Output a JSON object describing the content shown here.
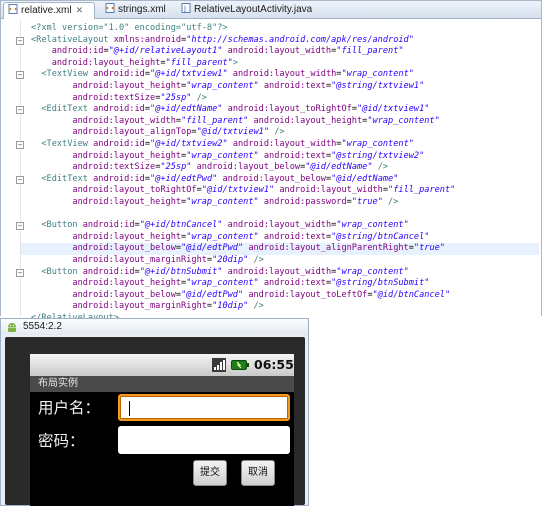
{
  "tabs": [
    {
      "label": "relative.xml",
      "active": true
    },
    {
      "label": "strings.xml",
      "active": false
    },
    {
      "label": "RelativeLayoutActivity.java",
      "active": false
    }
  ],
  "code_lines": [
    [
      [
        "pi",
        "<?xml version=\"1.0\" encoding=\"utf-8\"?>"
      ]
    ],
    [
      [
        "tag",
        "<RelativeLayout "
      ],
      [
        "attr",
        "xmlns:android"
      ],
      [
        "punc",
        "="
      ],
      [
        "val",
        "\"http://schemas.android.com/apk/res/android\""
      ]
    ],
    [
      [
        "attr",
        "    android:id"
      ],
      [
        "punc",
        "="
      ],
      [
        "val",
        "\"@+id/relativeLayout1\""
      ],
      [
        "attr",
        " android:layout_width"
      ],
      [
        "punc",
        "="
      ],
      [
        "val",
        "\"fill_parent\""
      ]
    ],
    [
      [
        "attr",
        "    android:layout_height"
      ],
      [
        "punc",
        "="
      ],
      [
        "val",
        "\"fill_parent\""
      ],
      [
        "tag",
        ">"
      ]
    ],
    [
      [
        "tag",
        "  <TextView "
      ],
      [
        "attr",
        "android:id"
      ],
      [
        "punc",
        "="
      ],
      [
        "val",
        "\"@+id/txtview1\""
      ],
      [
        "attr",
        " android:layout_width"
      ],
      [
        "punc",
        "="
      ],
      [
        "val",
        "\"wrap_content\""
      ]
    ],
    [
      [
        "attr",
        "        android:layout_height"
      ],
      [
        "punc",
        "="
      ],
      [
        "val",
        "\"wrap_content\""
      ],
      [
        "attr",
        " android:text"
      ],
      [
        "punc",
        "="
      ],
      [
        "val",
        "\"@string/txtview1\""
      ]
    ],
    [
      [
        "attr",
        "        android:textSize"
      ],
      [
        "punc",
        "="
      ],
      [
        "val",
        "\"25sp\""
      ],
      [
        "tag",
        " />"
      ]
    ],
    [
      [
        "tag",
        "  <EditText "
      ],
      [
        "attr",
        "android:id"
      ],
      [
        "punc",
        "="
      ],
      [
        "val",
        "\"@+id/edtName\""
      ],
      [
        "attr",
        " android:layout_toRightOf"
      ],
      [
        "punc",
        "="
      ],
      [
        "val",
        "\"@id/txtview1\""
      ]
    ],
    [
      [
        "attr",
        "        android:layout_width"
      ],
      [
        "punc",
        "="
      ],
      [
        "val",
        "\"fill_parent\""
      ],
      [
        "attr",
        " android:layout_height"
      ],
      [
        "punc",
        "="
      ],
      [
        "val",
        "\"wrap_content\""
      ]
    ],
    [
      [
        "attr",
        "        android:layout_alignTop"
      ],
      [
        "punc",
        "="
      ],
      [
        "val",
        "\"@id/txtview1\""
      ],
      [
        "tag",
        " />"
      ]
    ],
    [
      [
        "tag",
        "  <TextView "
      ],
      [
        "attr",
        "android:id"
      ],
      [
        "punc",
        "="
      ],
      [
        "val",
        "\"@+id/txtview2\""
      ],
      [
        "attr",
        " android:layout_width"
      ],
      [
        "punc",
        "="
      ],
      [
        "val",
        "\"wrap_content\""
      ]
    ],
    [
      [
        "attr",
        "        android:layout_height"
      ],
      [
        "punc",
        "="
      ],
      [
        "val",
        "\"wrap_content\""
      ],
      [
        "attr",
        " android:text"
      ],
      [
        "punc",
        "="
      ],
      [
        "val",
        "\"@string/txtview2\""
      ]
    ],
    [
      [
        "attr",
        "        android:textSize"
      ],
      [
        "punc",
        "="
      ],
      [
        "val",
        "\"25sp\""
      ],
      [
        "attr",
        " android:layout_below"
      ],
      [
        "punc",
        "="
      ],
      [
        "val",
        "\"@id/edtName\""
      ],
      [
        "tag",
        " />"
      ]
    ],
    [
      [
        "tag",
        "  <EditText "
      ],
      [
        "attr",
        "android:id"
      ],
      [
        "punc",
        "="
      ],
      [
        "val",
        "\"@+id/edtPwd\""
      ],
      [
        "attr",
        " android:layout_below"
      ],
      [
        "punc",
        "="
      ],
      [
        "val",
        "\"@id/edtName\""
      ]
    ],
    [
      [
        "attr",
        "        android:layout_toRightOf"
      ],
      [
        "punc",
        "="
      ],
      [
        "val",
        "\"@id/txtview1\""
      ],
      [
        "attr",
        " android:layout_width"
      ],
      [
        "punc",
        "="
      ],
      [
        "val",
        "\"fill_parent\""
      ]
    ],
    [
      [
        "attr",
        "        android:layout_height"
      ],
      [
        "punc",
        "="
      ],
      [
        "val",
        "\"wrap_content\""
      ],
      [
        "attr",
        " android:password"
      ],
      [
        "punc",
        "="
      ],
      [
        "val",
        "\"true\""
      ],
      [
        "tag",
        " />"
      ]
    ],
    [],
    [
      [
        "tag",
        "  <Button "
      ],
      [
        "attr",
        "android:id"
      ],
      [
        "punc",
        "="
      ],
      [
        "val",
        "\"@+id/btnCancel\""
      ],
      [
        "attr",
        " android:layout_width"
      ],
      [
        "punc",
        "="
      ],
      [
        "val",
        "\"wrap_content\""
      ]
    ],
    [
      [
        "attr",
        "        android:layout_height"
      ],
      [
        "punc",
        "="
      ],
      [
        "val",
        "\"wrap_content\""
      ],
      [
        "attr",
        " android:text"
      ],
      [
        "punc",
        "="
      ],
      [
        "val",
        "\"@string/btnCancel\""
      ]
    ],
    [
      [
        "attr",
        "        android:layout_below"
      ],
      [
        "punc",
        "="
      ],
      [
        "val",
        "\"@id/edtPwd\""
      ],
      [
        "attr",
        " android:layout_alignParentRight"
      ],
      [
        "punc",
        "="
      ],
      [
        "val",
        "\"true\""
      ]
    ],
    [
      [
        "attr",
        "        android:layout_marginRight"
      ],
      [
        "punc",
        "="
      ],
      [
        "val",
        "\"20dip\""
      ],
      [
        "tag",
        " />"
      ]
    ],
    [
      [
        "tag",
        "  <Button "
      ],
      [
        "attr",
        "android:id"
      ],
      [
        "punc",
        "="
      ],
      [
        "val",
        "\"@+id/btnSubmit\""
      ],
      [
        "attr",
        " android:layout_width"
      ],
      [
        "punc",
        "="
      ],
      [
        "val",
        "\"wrap_content\""
      ]
    ],
    [
      [
        "attr",
        "        android:layout_height"
      ],
      [
        "punc",
        "="
      ],
      [
        "val",
        "\"wrap_content\""
      ],
      [
        "attr",
        " android:text"
      ],
      [
        "punc",
        "="
      ],
      [
        "val",
        "\"@string/btnSubmit\""
      ]
    ],
    [
      [
        "attr",
        "        android:layout_below"
      ],
      [
        "punc",
        "="
      ],
      [
        "val",
        "\"@id/edtPwd\""
      ],
      [
        "attr",
        " android:layout_toLeftOf"
      ],
      [
        "punc",
        "="
      ],
      [
        "val",
        "\"@id/btnCancel\""
      ]
    ],
    [
      [
        "attr",
        "        android:layout_marginRight"
      ],
      [
        "punc",
        "="
      ],
      [
        "val",
        "\"10dip\""
      ],
      [
        "tag",
        " />"
      ]
    ],
    [
      [
        "tag",
        "</RelativeLayout>"
      ]
    ]
  ],
  "highlighted_line": 19,
  "emulator": {
    "title": "5554:2.2",
    "status_time": "06:55",
    "app_title": "布局实例",
    "username_label": "用户名：",
    "password_label": "密码：",
    "username_value": "",
    "password_value": "",
    "submit_label": "提交",
    "cancel_label": "取消"
  },
  "colors": {
    "focus_border": "#f39a1e",
    "xml_tag": "#3f7f7f",
    "xml_attr": "#7f007f",
    "xml_value": "#2a00ff"
  }
}
